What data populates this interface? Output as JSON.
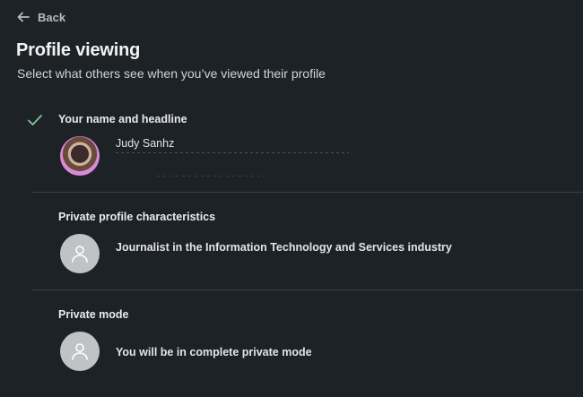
{
  "nav": {
    "back_label": "Back"
  },
  "header": {
    "title": "Profile viewing",
    "subtitle": "Select what others see when you’ve viewed their profile"
  },
  "options": [
    {
      "title": "Your name and headline",
      "selected": true,
      "detail": "Judy Sanhz",
      "avatar": "profile-photo"
    },
    {
      "title": "Private profile characteristics",
      "selected": false,
      "detail": "Journalist in the Information Technology and Services industry",
      "avatar": "anonymous-person-icon"
    },
    {
      "title": "Private mode",
      "selected": false,
      "detail": "You will be in complete private mode",
      "avatar": "anonymous-person-icon"
    }
  ],
  "colors": {
    "background": "#1d2226",
    "check": "#7ec89a",
    "divider": "#3a4045",
    "placeholder": "#bfc3c6"
  }
}
